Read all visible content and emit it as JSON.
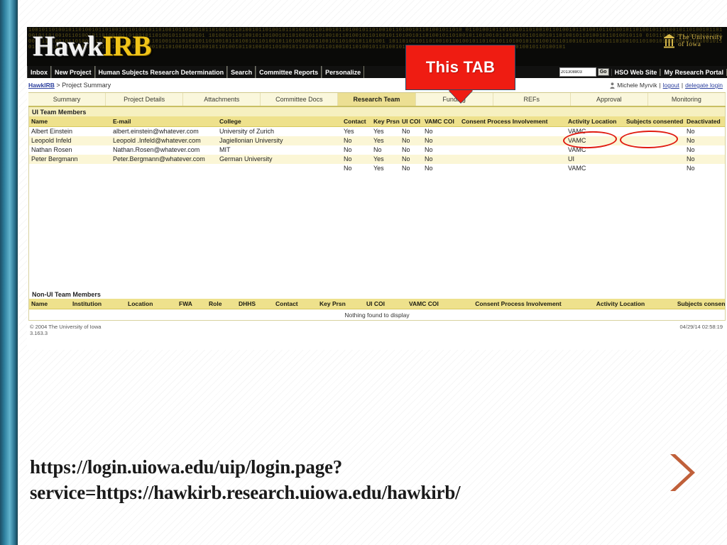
{
  "slide": {
    "url_text": "https://login.uiowa.edu/uip/login.page?service=https://hawkirb.research.uiowa.edu/hawkirb/",
    "chevron_icon": "chevron-right-icon",
    "chevron_color": "#c0603a",
    "accent_teal": "#2e7f9e"
  },
  "callout": {
    "label": "This TAB",
    "bg_color": "#ef1c12",
    "text_color": "#ffffff",
    "border_color": "#2a4763"
  },
  "annotations": {
    "ellipse_color": "#e01b10",
    "circled": [
      "Activity Location",
      "Subjects consented"
    ]
  },
  "app": {
    "masthead": {
      "logo_first": "Hawk",
      "logo_second": "IRB",
      "binary_texture": "1001011010010110100101101001011010010110100101101001011010010110100101101001011010010110100101101001011010010110100101101001011010 0110100101101001011010010110100101101001011010010110100101101001011010010110100101101001011010010110100101101001011010010110100101 1010010110100101101001011010010110100101101001011010010110100101101001011010010110100101101001011010010110100101101001011010010110 0101101001011010010110100101101001011010010110100101101001011010010110100101101001011010010110100101101001011010010110100101101001 1011010010110100101101001011010010110100101101001011010010110100101101001011010010110100101101001011010010110100101101001011010010 0110100101101001011010010110100101101001011010010110100101101001011010010110100101101001011010010110100101101001011010010110100101",
      "university_logo": {
        "icon": "university-column-icon",
        "line1": "The University",
        "line2": "of Iowa"
      }
    },
    "nav": {
      "items": [
        {
          "label": "Inbox",
          "name": "nav-inbox"
        },
        {
          "label": "New Project",
          "name": "nav-new-project"
        },
        {
          "label": "Human Subjects Research Determination",
          "name": "nav-hsrd"
        },
        {
          "label": "Search",
          "name": "nav-search"
        },
        {
          "label": "Committee Reports",
          "name": "nav-committee-reports"
        },
        {
          "label": "Personalize",
          "name": "nav-personalize"
        }
      ],
      "search_value": "201308803",
      "search_placeholder": "",
      "go_label": "Go",
      "right_items": [
        {
          "label": "HSO Web Site",
          "name": "nav-hso-web-site"
        },
        {
          "label": "My Research Portal",
          "name": "nav-my-research-portal"
        }
      ]
    },
    "breadcrumb": {
      "home": "HawkIRB",
      "separator": ">",
      "current": "Project Summary"
    },
    "user": {
      "icon": "user-icon",
      "name": "Michele Myrvik",
      "sep": "|",
      "logout": "logout",
      "delegate": "delegate login"
    },
    "tabs": [
      {
        "label": "Summary",
        "name": "tab-summary",
        "active": false
      },
      {
        "label": "Project Details",
        "name": "tab-project-details",
        "active": false
      },
      {
        "label": "Attachments",
        "name": "tab-attachments",
        "active": false
      },
      {
        "label": "Committee Docs",
        "name": "tab-committee-docs",
        "active": false
      },
      {
        "label": "Research Team",
        "name": "tab-research-team",
        "active": true
      },
      {
        "label": "Funding",
        "name": "tab-funding",
        "active": false
      },
      {
        "label": "REFs",
        "name": "tab-refs",
        "active": false
      },
      {
        "label": "Approval",
        "name": "tab-approval",
        "active": false
      },
      {
        "label": "Monitoring",
        "name": "tab-monitoring",
        "active": false
      }
    ],
    "ui_team": {
      "title": "UI Team Members",
      "columns": [
        "Name",
        "E-mail",
        "College",
        "Contact",
        "Key Prsn",
        "UI COI",
        "VAMC COI",
        "Consent Process Involvement",
        "Activity Location",
        "Subjects consented",
        "Deactivated"
      ],
      "rows": [
        {
          "name": "Albert Einstein",
          "email": "albert.einstein@whatever.com",
          "college": "University of Zurich",
          "contact": "Yes",
          "key_prsn": "Yes",
          "ui_coi": "No",
          "vamc_coi": "No",
          "consent_process": "",
          "activity_location": "VAMC",
          "subjects_consented": "",
          "deactivated": "No"
        },
        {
          "name": "Leopold Infeld",
          "email": "Leopold .Infeld@whatever.com",
          "college": "Jagiellonian University",
          "contact": "No",
          "key_prsn": "Yes",
          "ui_coi": "No",
          "vamc_coi": "No",
          "consent_process": "",
          "activity_location": "VAMC",
          "subjects_consented": "",
          "deactivated": "No"
        },
        {
          "name": "Nathan Rosen",
          "email": "Nathan.Rosen@whatever.com",
          "college": "MIT",
          "contact": "No",
          "key_prsn": "No",
          "ui_coi": "No",
          "vamc_coi": "No",
          "consent_process": "",
          "activity_location": "VAMC",
          "subjects_consented": "",
          "deactivated": "No"
        },
        {
          "name": "Peter Bergmann",
          "email": "Peter.Bergmann@whatever.com",
          "college": "German University",
          "contact": "No",
          "key_prsn": "Yes",
          "ui_coi": "No",
          "vamc_coi": "No",
          "consent_process": "",
          "activity_location": "UI",
          "subjects_consented": "",
          "deactivated": "No"
        },
        {
          "name": "",
          "email": "",
          "college": "",
          "contact": "No",
          "key_prsn": "Yes",
          "ui_coi": "No",
          "vamc_coi": "No",
          "consent_process": "",
          "activity_location": "VAMC",
          "subjects_consented": "",
          "deactivated": "No"
        }
      ]
    },
    "non_ui_team": {
      "title": "Non-UI Team Members",
      "columns": [
        "Name",
        "Institution",
        "Location",
        "FWA",
        "Role",
        "DHHS",
        "Contact",
        "Key Prsn",
        "UI COI",
        "VAMC COI",
        "Consent Process Involvement",
        "Activity Location",
        "Subjects consented"
      ],
      "empty_message": "Nothing found to display"
    },
    "footer": {
      "copyright": "© 2004 The University of Iowa",
      "version": "3.163.3",
      "timestamp": "04/29/14 02:58:19"
    }
  }
}
